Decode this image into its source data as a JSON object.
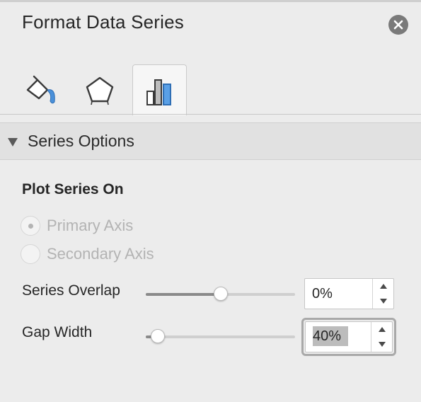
{
  "panel": {
    "title": "Format Data Series",
    "close_icon": "close-icon"
  },
  "tabs": [
    {
      "name": "fill-and-line",
      "icon": "paint-bucket-icon",
      "selected": false
    },
    {
      "name": "effects",
      "icon": "pentagon-icon",
      "selected": false
    },
    {
      "name": "series-options",
      "icon": "bar-chart-icon",
      "selected": true
    }
  ],
  "section": {
    "label": "Series Options",
    "expanded": true,
    "icon": "triangle-down-icon"
  },
  "plot_series_on": {
    "heading": "Plot Series On",
    "options": [
      {
        "label": "Primary Axis",
        "selected": true,
        "disabled": true
      },
      {
        "label": "Secondary Axis",
        "selected": false,
        "disabled": true
      }
    ]
  },
  "series_overlap": {
    "label": "Series Overlap",
    "value": "0%",
    "slider_fraction": 0.5
  },
  "gap_width": {
    "label": "Gap Width",
    "value": "40%",
    "slider_fraction": 0.08,
    "focused": true
  },
  "colors": {
    "accent_blue": "#4a90d9",
    "panel_bg": "#ececec",
    "section_bg": "#e1e1e1",
    "disabled_text": "#b3b3b3"
  }
}
